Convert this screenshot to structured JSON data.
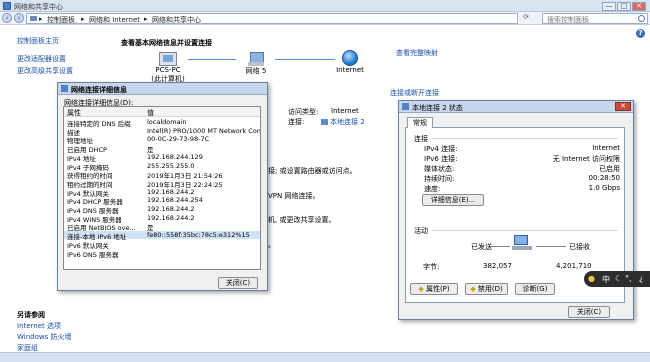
{
  "window": {
    "title": "网络和共享中心",
    "controls": {
      "minimize": "—",
      "maximize": "□",
      "close": "✕"
    }
  },
  "addressbar": {
    "crumbs": [
      "控制面板",
      "网络和 Internet",
      "网络和共享中心"
    ],
    "search_placeholder": "搜索控制面板"
  },
  "sidebar": {
    "items": [
      {
        "label": "控制面板主页"
      },
      {
        "label": "更改适配器设置"
      },
      {
        "label": "更改高级共享设置"
      }
    ],
    "see_also_title": "另请参阅",
    "see_also": [
      {
        "label": "Internet 选项"
      },
      {
        "label": "Windows 防火墙"
      },
      {
        "label": "家庭组"
      }
    ]
  },
  "main": {
    "heading": "查看基本网络信息并设置连接",
    "full_map_link": "查看完整映射",
    "connect_link": "连接或断开连接",
    "nodes": [
      {
        "name": "PCS-PC",
        "sub": "(此计算机)"
      },
      {
        "name": "网络 5"
      },
      {
        "name": "Internet"
      }
    ],
    "access_type_label": "访问类型:",
    "access_type_value": "Internet",
    "connections_label": "连接:",
    "connections_value": "本地连接 2",
    "fragments": [
      "接; 或设置路由器或访问点。",
      "VPN 网络连接。",
      "机, 或更改共享设置。",
      "。"
    ]
  },
  "details_dialog": {
    "title": "网络连接详细信息",
    "caption": "网络连接详细信息(D):",
    "col_property": "属性",
    "col_value": "值",
    "rows": [
      {
        "k": "连接特定的 DNS 后缀",
        "v": "localdomain"
      },
      {
        "k": "描述",
        "v": "Intel(R) PRO/1000 MT Network Conn"
      },
      {
        "k": "物理地址",
        "v": "00-0C-29-73-98-7C"
      },
      {
        "k": "已启用 DHCP",
        "v": "是"
      },
      {
        "k": "IPv4 地址",
        "v": "192.168.244.129"
      },
      {
        "k": "IPv4 子网掩码",
        "v": "255.255.255.0"
      },
      {
        "k": "获得租约的时间",
        "v": "2019年1月3日 21:54:26"
      },
      {
        "k": "租约过期的时间",
        "v": "2019年1月3日 22:24:25"
      },
      {
        "k": "IPv4 默认网关",
        "v": "192.168.244.2"
      },
      {
        "k": "IPv4 DHCP 服务器",
        "v": "192.168.244.254"
      },
      {
        "k": "IPv4 DNS 服务器",
        "v": "192.168.244.2"
      },
      {
        "k": "IPv4 WINS 服务器",
        "v": "192.168.244.2"
      },
      {
        "k": "已启用 NetBIOS ove...",
        "v": "是"
      },
      {
        "k": "连接-本地 IPv6 地址",
        "v": "fe80::558f:35bc:78c5:e312%15"
      },
      {
        "k": "IPv6 默认网关",
        "v": ""
      },
      {
        "k": "IPv6 DNS 服务器",
        "v": ""
      }
    ],
    "close_button": "关闭(C)"
  },
  "status_dialog": {
    "title": "本地连接 2 状态",
    "tab": "常规",
    "connection_group": "连接",
    "rows": [
      {
        "k": "IPv4 连接:",
        "v": "Internet"
      },
      {
        "k": "IPv6 连接:",
        "v": "无 Internet 访问权限"
      },
      {
        "k": "媒体状态:",
        "v": "已启用"
      },
      {
        "k": "持续时间:",
        "v": "00:28:50"
      },
      {
        "k": "速度:",
        "v": "1.0 Gbps"
      }
    ],
    "details_button": "详细信息(E)...",
    "activity_group": "活动",
    "sent_label": "已发送",
    "received_label": "已接收",
    "bytes_label": "字节:",
    "bytes_sent": "382,057",
    "bytes_received": "4,201,710",
    "properties_button": "属性(P)",
    "disable_button": "禁用(D)",
    "diagnose_button": "诊断(G)",
    "close_button": "关闭(C)"
  },
  "ime": {
    "lang": "中",
    "moon": "☾",
    "punct": "°,",
    "extra": "¿"
  }
}
